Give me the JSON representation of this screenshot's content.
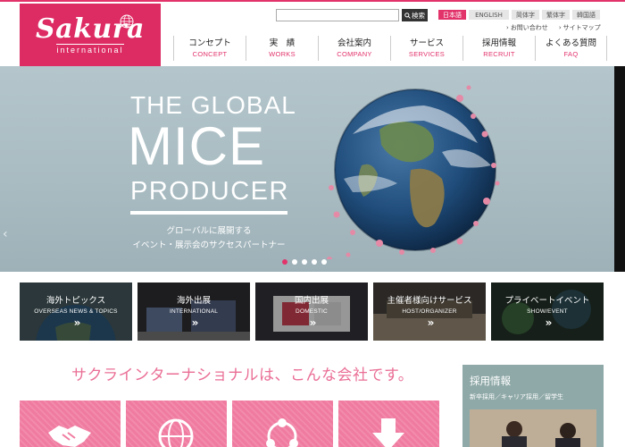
{
  "header": {
    "logo_main": "Sakura",
    "logo_sub": "international",
    "search": {
      "placeholder": "",
      "button_label": "検索"
    },
    "languages": [
      {
        "label": "日本語",
        "active": true
      },
      {
        "label": "ENGLISH",
        "active": false
      },
      {
        "label": "简体字",
        "active": false
      },
      {
        "label": "繁体字",
        "active": false
      },
      {
        "label": "韓国語",
        "active": false
      }
    ],
    "sublinks": [
      "お問い合わせ",
      "サイトマップ"
    ],
    "nav": [
      {
        "jp": "コンセプト",
        "en": "CONCEPT"
      },
      {
        "jp": "実　績",
        "en": "WORKS"
      },
      {
        "jp": "会社案内",
        "en": "COMPANY"
      },
      {
        "jp": "サービス",
        "en": "SERVICES"
      },
      {
        "jp": "採用情報",
        "en": "RECRUIT"
      },
      {
        "jp": "よくある質問",
        "en": "FAQ"
      }
    ]
  },
  "hero": {
    "line1": "THE GLOBAL",
    "line2": "MICE",
    "line3": "PRODUCER",
    "tagline1": "グローバルに展開する",
    "tagline2": "イベント・展示会のサクセスパートナー",
    "slide_count": 5,
    "active_slide": 0,
    "prev_arrow": "‹",
    "next_arrow": "›"
  },
  "tiles": [
    {
      "jp": "海外トピックス",
      "en": "OVERSEAS NEWS & TOPICS",
      "chev": "»"
    },
    {
      "jp": "海外出展",
      "en": "INTERNATIONAL",
      "chev": "»"
    },
    {
      "jp": "国内出展",
      "en": "DOMESTIC",
      "chev": "»"
    },
    {
      "jp": "主催者様向けサービス",
      "en": "HOST/ORGANIZER",
      "chev": "»"
    },
    {
      "jp": "プライベートイベント",
      "en": "SHOW/EVENT",
      "chev": "»"
    }
  ],
  "intro": {
    "title": "サクラインターナショナルは、こんな会社です。"
  },
  "recruit": {
    "title": "採用情報",
    "subtitle": "新卒採用／キャリア採用／留学生"
  },
  "colors": {
    "brand_pink": "#e2336b",
    "nav_en": "#e2336b",
    "intro_pink": "#ea6f96",
    "card_pink": "#f07ba0",
    "recruit_bg": "#8fa9a8"
  }
}
